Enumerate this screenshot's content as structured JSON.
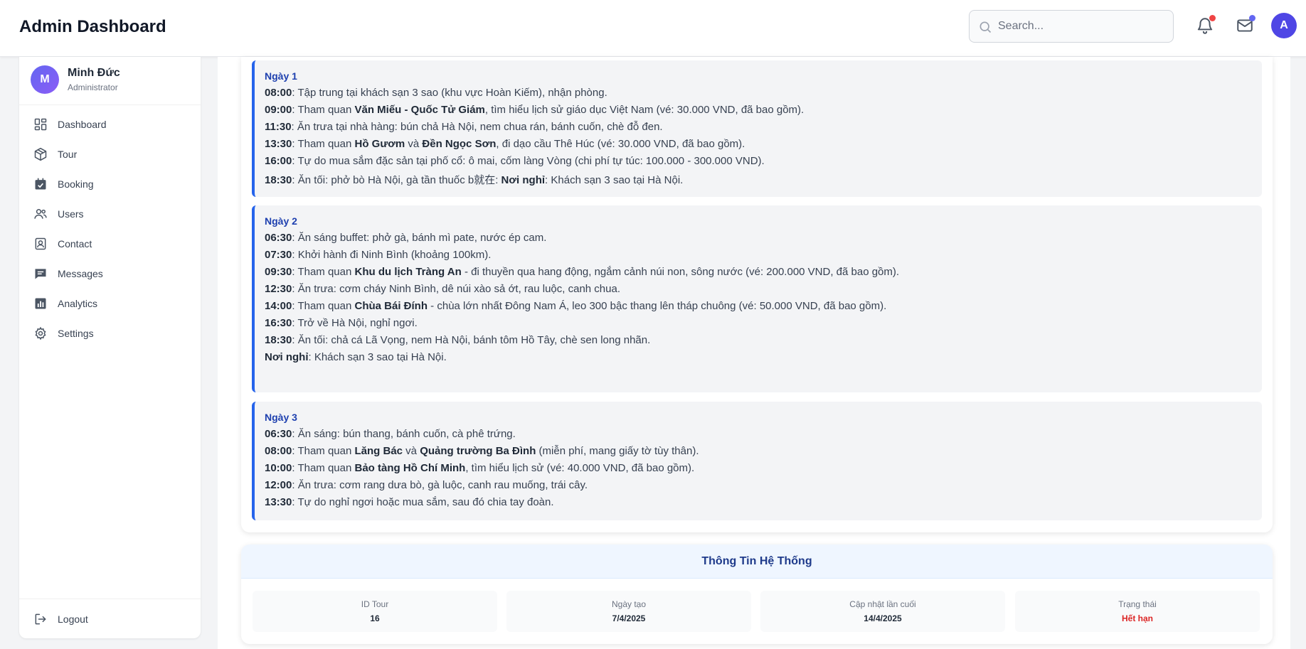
{
  "header": {
    "title": "Admin Dashboard",
    "search_placeholder": "Search...",
    "avatar_letter": "A",
    "colors": {
      "notification_dot": "#ef4444",
      "mail_dot": "#6366f1",
      "avatar": "#4f46e5"
    }
  },
  "sidebar": {
    "profile": {
      "initial": "M",
      "name": "Minh Đức",
      "role": "Administrator"
    },
    "items": [
      {
        "label": "Dashboard",
        "icon": "dashboard-icon"
      },
      {
        "label": "Tour",
        "icon": "box-icon"
      },
      {
        "label": "Booking",
        "icon": "calendar-check-icon"
      },
      {
        "label": "Users",
        "icon": "users-icon"
      },
      {
        "label": "Contact",
        "icon": "contact-icon"
      },
      {
        "label": "Messages",
        "icon": "message-icon"
      },
      {
        "label": "Analytics",
        "icon": "chart-icon"
      },
      {
        "label": "Settings",
        "icon": "gear-icon"
      }
    ],
    "logout": "Logout"
  },
  "itinerary": {
    "accent": "#2563eb",
    "days": [
      {
        "title": "Ngày 1",
        "lines": [
          [
            {
              "b": "08:00"
            },
            {
              "t": ": Tập trung tại khách sạn 3 sao (khu vực Hoàn Kiếm), nhận phòng."
            }
          ],
          [
            {
              "b": "09:00"
            },
            {
              "t": ": Tham quan "
            },
            {
              "b": "Văn Miếu - Quốc Tử Giám"
            },
            {
              "t": ", tìm hiểu lịch sử giáo dục Việt Nam (vé: 30.000 VND, đã bao gồm)."
            }
          ],
          [
            {
              "b": "11:30"
            },
            {
              "t": ": Ăn trưa tại nhà hàng: bún chả Hà Nội, nem chua rán, bánh cuốn, chè đỗ đen."
            }
          ],
          [
            {
              "b": "13:30"
            },
            {
              "t": ": Tham quan "
            },
            {
              "b": "Hồ Gươm"
            },
            {
              "t": " và "
            },
            {
              "b": "Đền Ngọc Sơn"
            },
            {
              "t": ", đi dạo cầu Thê Húc (vé: 30.000 VND, đã bao gồm)."
            }
          ],
          [
            {
              "b": "16:00"
            },
            {
              "t": ": Tự do mua sắm đặc sản tại phố cổ: ô mai, cốm làng Vòng (chi phí tự túc: 100.000 - 300.000 VND)."
            }
          ],
          [
            {
              "b": "18:30"
            },
            {
              "t": ": Ăn tối: phở bò Hà Nội, gà tần thuốc b就在: "
            },
            {
              "b": "Nơi nghỉ"
            },
            {
              "t": ": Khách sạn 3 sao tại Hà Nội."
            }
          ]
        ]
      },
      {
        "title": "Ngày 2",
        "lines": [
          [
            {
              "b": "06:30"
            },
            {
              "t": ": Ăn sáng buffet: phở gà, bánh mì pate, nước ép cam."
            }
          ],
          [
            {
              "b": "07:30"
            },
            {
              "t": ": Khởi hành đi Ninh Bình (khoảng 100km)."
            }
          ],
          [
            {
              "b": "09:30"
            },
            {
              "t": ": Tham quan "
            },
            {
              "b": "Khu du lịch Tràng An"
            },
            {
              "t": " - đi thuyền qua hang động, ngắm cảnh núi non, sông nước (vé: 200.000 VND, đã bao gồm)."
            }
          ],
          [
            {
              "b": "12:30"
            },
            {
              "t": ": Ăn trưa: cơm cháy Ninh Bình, dê núi xào sả ớt, rau luộc, canh chua."
            }
          ],
          [
            {
              "b": "14:00"
            },
            {
              "t": ": Tham quan "
            },
            {
              "b": "Chùa Bái Đính"
            },
            {
              "t": " - chùa lớn nhất Đông Nam Á, leo 300 bậc thang lên tháp chuông (vé: 50.000 VND, đã bao gồm)."
            }
          ],
          [
            {
              "b": "16:30"
            },
            {
              "t": ": Trở về Hà Nội, nghỉ ngơi."
            }
          ],
          [
            {
              "b": "18:30"
            },
            {
              "t": ": Ăn tối: chả cá Lã Vọng, nem Hà Nội, bánh tôm Hồ Tây, chè sen long nhãn."
            }
          ],
          [
            {
              "b": "Nơi nghỉ"
            },
            {
              "t": ": Khách sạn 3 sao tại Hà Nội."
            }
          ]
        ]
      },
      {
        "title": "Ngày 3",
        "lines": [
          [
            {
              "b": "06:30"
            },
            {
              "t": ": Ăn sáng: bún thang, bánh cuốn, cà phê trứng."
            }
          ],
          [
            {
              "b": "08:00"
            },
            {
              "t": ": Tham quan "
            },
            {
              "b": "Lăng Bác"
            },
            {
              "t": " và "
            },
            {
              "b": "Quảng trường Ba Đình"
            },
            {
              "t": " (miễn phí, mang giấy tờ tùy thân)."
            }
          ],
          [
            {
              "b": "10:00"
            },
            {
              "t": ": Tham quan "
            },
            {
              "b": "Bảo tàng Hồ Chí Minh"
            },
            {
              "t": ", tìm hiểu lịch sử (vé: 40.000 VND, đã bao gồm)."
            }
          ],
          [
            {
              "b": "12:00"
            },
            {
              "t": ": Ăn trưa: cơm rang dưa bò, gà luộc, canh rau muống, trái cây."
            }
          ],
          [
            {
              "b": "13:30"
            },
            {
              "t": ": Tự do nghỉ ngơi hoặc mua sắm, sau đó chia tay đoàn."
            }
          ]
        ]
      }
    ]
  },
  "system_info": {
    "title": "Thông Tin Hệ Thống",
    "fields": [
      {
        "label": "ID Tour",
        "value": "16"
      },
      {
        "label": "Ngày tạo",
        "value": "7/4/2025"
      },
      {
        "label": "Cập nhật lần cuối",
        "value": "14/4/2025"
      },
      {
        "label": "Trạng thái",
        "value": "Hết hạn",
        "color": "#dc2626"
      }
    ]
  }
}
